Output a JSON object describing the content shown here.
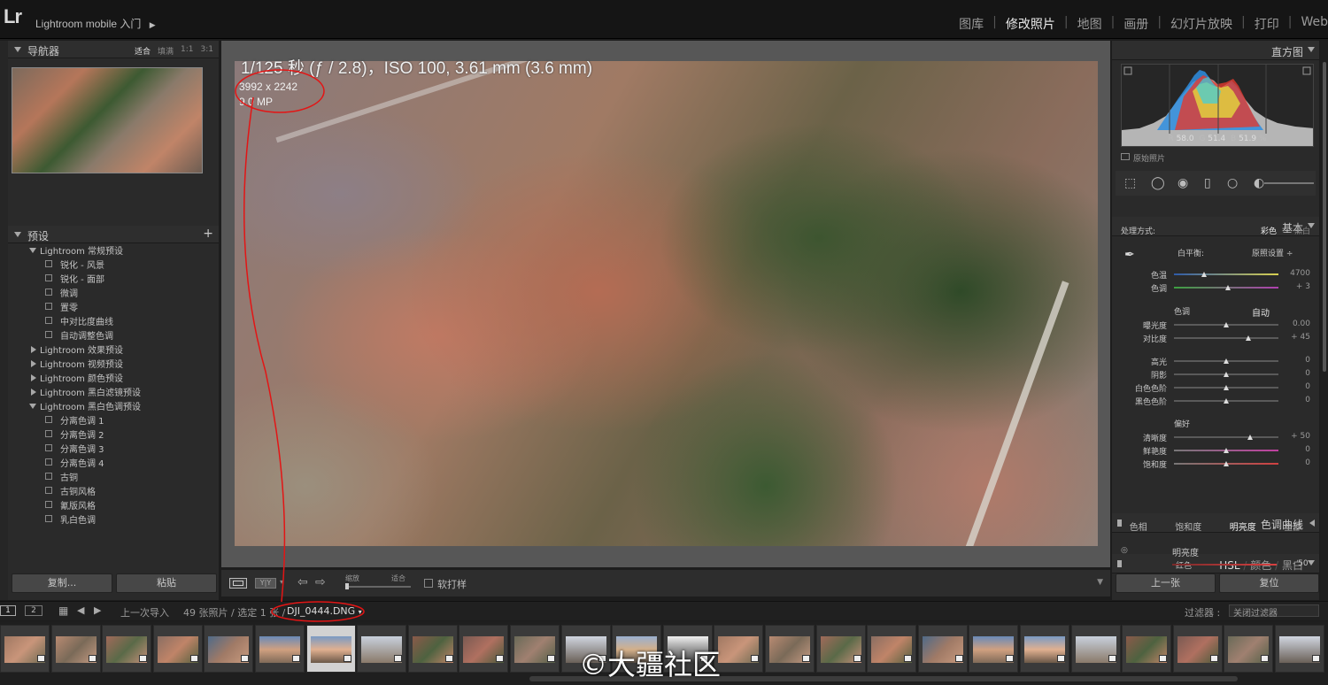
{
  "topbar": {
    "logo": "Lr",
    "title": "Lightroom mobile 入门",
    "modules": [
      "图库",
      "修改照片",
      "地图",
      "画册",
      "幻灯片放映",
      "打印",
      "Web"
    ],
    "active_module": "修改照片"
  },
  "navigator": {
    "title": "导航器",
    "options": [
      "适合",
      "填满",
      "1:1",
      "3:1"
    ],
    "active_option": "适合"
  },
  "presets": {
    "title": "预设",
    "add_symbol": "+",
    "rows": [
      {
        "type": "folder",
        "open": true,
        "label": "Lightroom 常规预设"
      },
      {
        "type": "item",
        "label": "锐化 - 风景"
      },
      {
        "type": "item",
        "label": "锐化 - 面部"
      },
      {
        "type": "item",
        "label": "微调"
      },
      {
        "type": "item",
        "label": "置零"
      },
      {
        "type": "item",
        "label": "中对比度曲线"
      },
      {
        "type": "item",
        "label": "自动调整色调"
      },
      {
        "type": "folder",
        "open": false,
        "label": "Lightroom 效果预设"
      },
      {
        "type": "folder",
        "open": false,
        "label": "Lightroom 视频预设"
      },
      {
        "type": "folder",
        "open": false,
        "label": "Lightroom 颜色预设"
      },
      {
        "type": "folder",
        "open": false,
        "label": "Lightroom 黑白滤镜预设"
      },
      {
        "type": "folder",
        "open": true,
        "label": "Lightroom 黑白色调预设"
      },
      {
        "type": "item",
        "label": "分离色调 1"
      },
      {
        "type": "item",
        "label": "分离色调 2"
      },
      {
        "type": "item",
        "label": "分离色调 3"
      },
      {
        "type": "item",
        "label": "分离色调 4"
      },
      {
        "type": "item",
        "label": "古铜"
      },
      {
        "type": "item",
        "label": "古铜风格"
      },
      {
        "type": "item",
        "label": "氰版风格"
      },
      {
        "type": "item",
        "label": "乳白色调"
      }
    ]
  },
  "left_buttons": {
    "copy": "复制...",
    "paste": "粘贴"
  },
  "photo_info": {
    "exif": "1/125 秒 (ƒ / 2.8)，ISO 100, 3.61 mm (3.6 mm)",
    "dimensions": "3992 x 2242",
    "megapixels": "9.0 MP"
  },
  "toolbar": {
    "zoom_label": "缩放",
    "zoom_fit": "适合",
    "soft_proof": "软打样"
  },
  "histogram": {
    "title": "直方图",
    "r_label": "R",
    "r_value": "58.0",
    "g_label": "G",
    "g_value": "51.4",
    "b_label": "B",
    "b_value": "51.9",
    "unit": "%",
    "original_photo": "原始照片"
  },
  "basic": {
    "title": "基本",
    "treatment_label": "处理方式:",
    "treatment_color": "彩色",
    "treatment_bw": "黑白",
    "wb_label": "白平衡:",
    "wb_value": "原照设置 ÷",
    "temp_label": "色温",
    "temp_value": "4700",
    "tint_label": "色调",
    "tint_value": "+ 3",
    "tone_title": "色调",
    "tone_auto": "自动",
    "sliders_tone": [
      {
        "label": "曝光度",
        "value": "0.00"
      },
      {
        "label": "对比度",
        "value": "+ 45"
      }
    ],
    "sliders_light": [
      {
        "label": "高光",
        "value": "0"
      },
      {
        "label": "阴影",
        "value": "0"
      },
      {
        "label": "白色色阶",
        "value": "0"
      },
      {
        "label": "黑色色阶",
        "value": "0"
      }
    ],
    "presence_title": "偏好",
    "sliders_presence": [
      {
        "label": "清晰度",
        "value": "+ 50"
      },
      {
        "label": "鲜艳度",
        "value": "0"
      },
      {
        "label": "饱和度",
        "value": "0"
      }
    ]
  },
  "tone_curve": {
    "title": "色调曲线"
  },
  "hsl": {
    "title_hsl": "HSL",
    "title_color": "颜色",
    "title_bw": "黑白",
    "tabs": [
      "色相",
      "饱和度",
      "明亮度",
      "全部"
    ],
    "active_tab": "明亮度",
    "section": "明亮度",
    "first_row_label": "红色",
    "first_row_value": "- 50"
  },
  "right_buttons": {
    "prev": "上一张",
    "reset": "复位"
  },
  "filmstrip_bar": {
    "page1": "1",
    "page2": "2",
    "source": "上一次导入",
    "count": "49 张照片 / 选定 1 张 /",
    "filename": "DJI_0444.DNG",
    "filter_label": "过滤器 :",
    "filter_value": "关闭过滤器"
  },
  "watermark": "©大疆社区"
}
